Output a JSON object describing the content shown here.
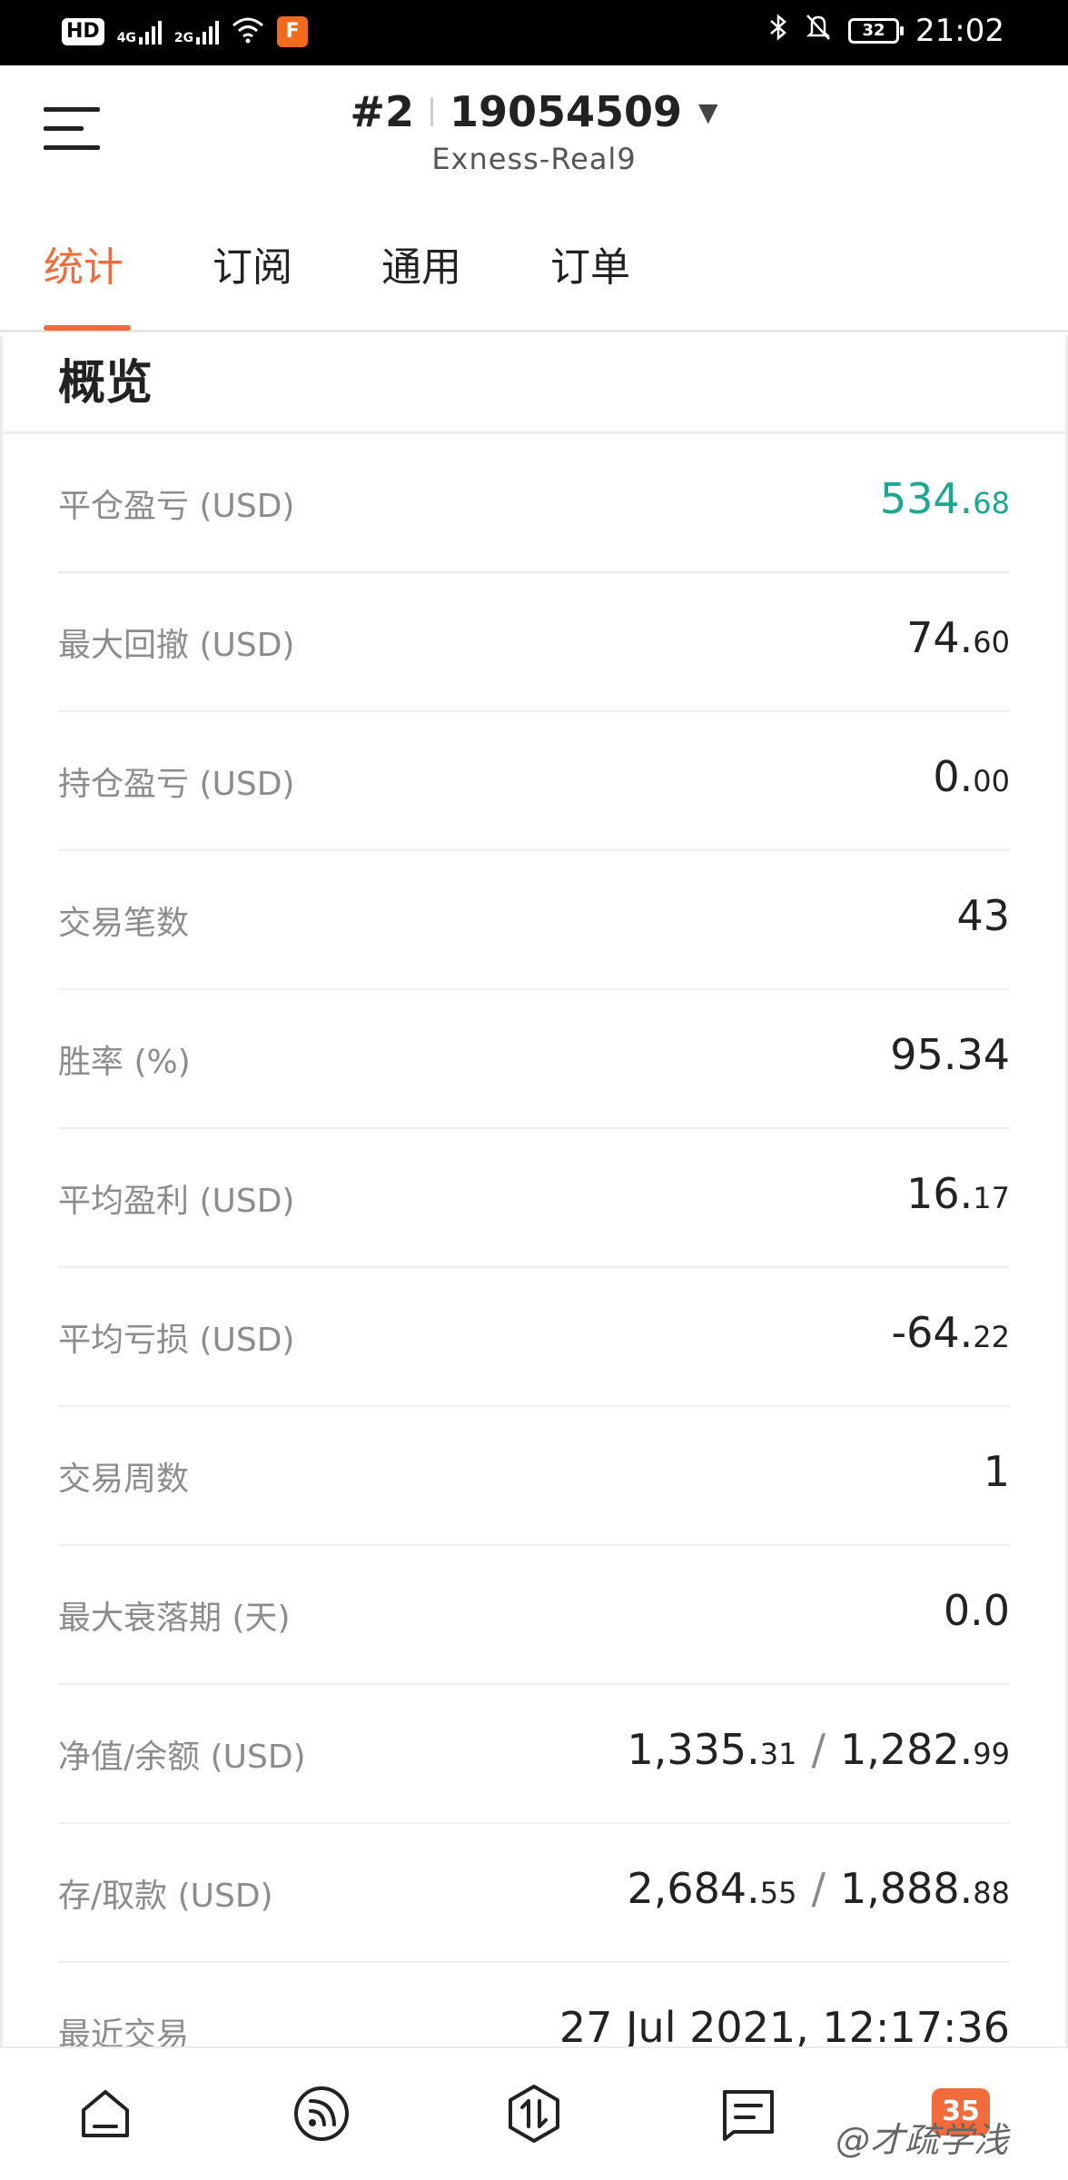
{
  "status_bar": {
    "hd": "HD",
    "net1": "4G",
    "net2": "2G",
    "app_icon_letter": "F",
    "battery": "32",
    "time": "21:02"
  },
  "header": {
    "account_index": "#2",
    "account_number": "19054509",
    "server": "Exness-Real9"
  },
  "tabs": [
    {
      "label": "统计",
      "active": true
    },
    {
      "label": "订阅",
      "active": false
    },
    {
      "label": "通用",
      "active": false
    },
    {
      "label": "订单",
      "active": false
    }
  ],
  "section": {
    "title": "概览"
  },
  "stats": [
    {
      "label": "平仓盈亏 (USD)",
      "int": "534.",
      "dec": "68",
      "color": "#1aa890"
    },
    {
      "label": "最大回撤 (USD)",
      "int": "74.",
      "dec": "60"
    },
    {
      "label": "持仓盈亏 (USD)",
      "int": "0.",
      "dec": "00"
    },
    {
      "label": "交易笔数",
      "int": "43",
      "dec": ""
    },
    {
      "label": "胜率 (%)",
      "int": "95.34",
      "dec": ""
    },
    {
      "label": "平均盈利 (USD)",
      "int": "16.",
      "dec": "17"
    },
    {
      "label": "平均亏损 (USD)",
      "int": "-64.",
      "dec": "22"
    },
    {
      "label": "交易周数",
      "int": "1",
      "dec": ""
    },
    {
      "label": "最大衰落期 (天)",
      "int": "0.0",
      "dec": ""
    },
    {
      "label": "净值/余额 (USD)",
      "int": "1,335.",
      "dec": "31",
      "int2": "1,282.",
      "dec2": "99"
    },
    {
      "label": "存/取款 (USD)",
      "int": "2,684.",
      "dec": "55",
      "int2": "1,888.",
      "dec2": "88"
    },
    {
      "label": "最近交易",
      "int": "27 Jul 2021, 12:17:36",
      "dec": ""
    }
  ],
  "bottom_nav": {
    "items": [
      "home-icon",
      "feed-icon",
      "trade-icon",
      "messages-icon"
    ],
    "badge": "35",
    "watermark": "@才疏学浅"
  }
}
